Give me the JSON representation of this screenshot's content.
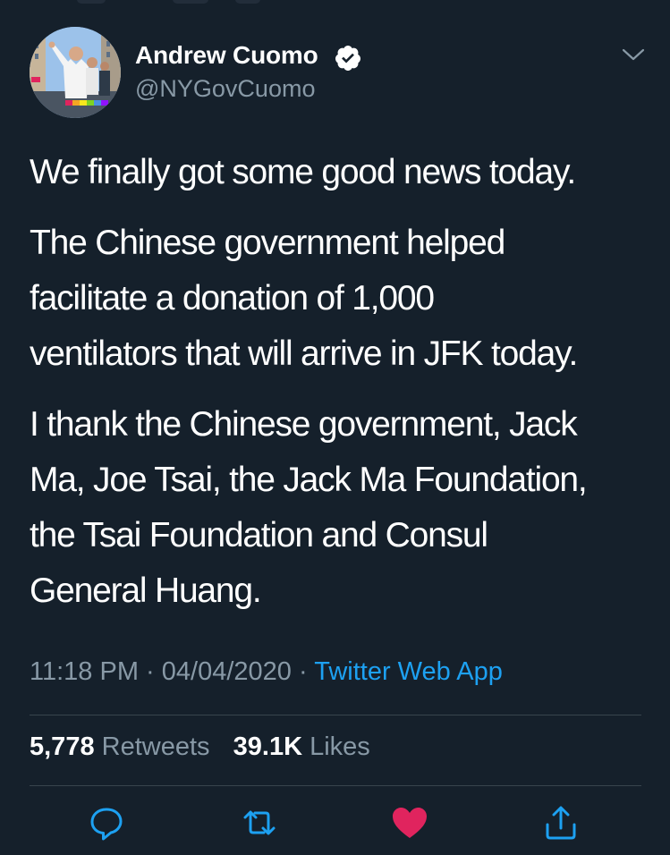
{
  "tweet": {
    "author": {
      "name": "Andrew Cuomo",
      "handle": "@NYGovCuomo",
      "verified": true
    },
    "paragraphs": [
      "We finally got some good news today.",
      "The Chinese government helped\nfacilitate a donation of 1,000\nventilators that will arrive in JFK today.",
      "I thank the Chinese government, Jack\nMa, Joe Tsai, the Jack Ma Foundation,\nthe Tsai Foundation and Consul\nGeneral Huang."
    ],
    "time": "11:18 PM",
    "separator": "·",
    "date": "04/04/2020",
    "source": "Twitter Web App",
    "retweets_count": "5,778",
    "retweets_label": "Retweets",
    "likes_count": "39.1K",
    "likes_label": "Likes"
  },
  "icons": {
    "verified": "verified-badge-icon",
    "menu": "chevron-down-icon",
    "reply": "reply-icon",
    "retweet": "retweet-icon",
    "like": "heart-icon",
    "share": "share-icon"
  },
  "colors": {
    "background": "#15202b",
    "text": "#ffffff",
    "muted": "#8899a6",
    "accent": "#1da1f2",
    "like": "#e0245e",
    "divider": "#38444d"
  }
}
